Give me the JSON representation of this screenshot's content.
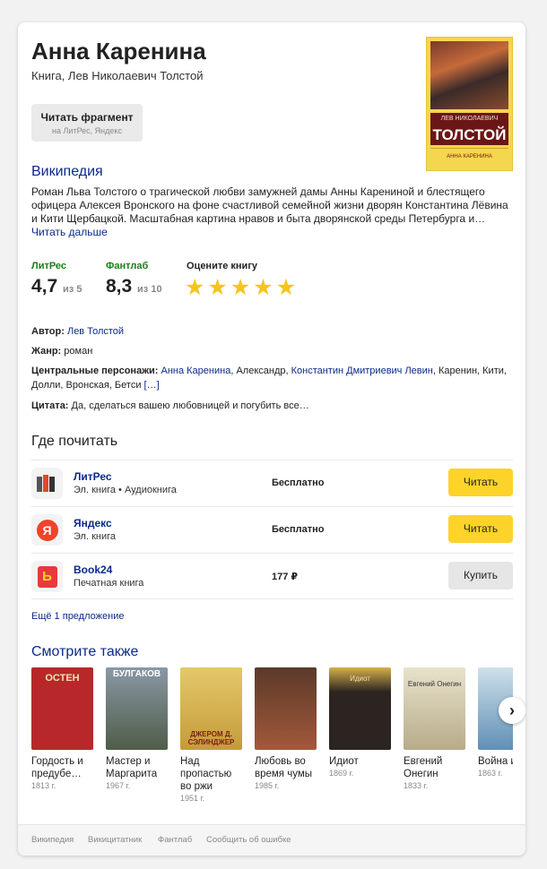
{
  "header": {
    "title": "Анна Каренина",
    "subtitle": "Книга, Лев Николаевич Толстой",
    "cover": {
      "author_line": "ЛЕВ НИКОЛАЕВИЧ",
      "name": "ТОЛСТОЙ",
      "title_line": "АННА КАРЕНИНА",
      "color": "#f5d64f"
    }
  },
  "fragment_button": {
    "label": "Читать фрагмент",
    "sub": "на ЛитРес, Яндекс"
  },
  "wiki": {
    "heading": "Википедия",
    "text": "Роман Льва Толстого о трагической любви замужней дамы Анны Карениной и блестящего офицера Алексея Вронского на фоне счастливой семейной жизни дворян Константина Лёвина и Кити Щербацкой. Масштабная картина нравов и быта дворянской среды Петербурга и…",
    "more": "Читать дальше"
  },
  "ratings": [
    {
      "source": "ЛитРес",
      "value": "4,7",
      "scale": "из 5"
    },
    {
      "source": "Фантлаб",
      "value": "8,3",
      "scale": "из 10"
    }
  ],
  "rate_prompt": "Оцените книгу",
  "stars": [
    "★",
    "★",
    "★",
    "★",
    "★"
  ],
  "info": {
    "author_label": "Автор:",
    "author": "Лев Толстой",
    "genre_label": "Жанр:",
    "genre": "роман",
    "chars_label": "Центральные персонажи:",
    "char1": "Анна Каренина",
    "sep1": ", Александр, ",
    "char2": "Константин Дмитриевич Левин",
    "sep2": ", Каренин, Кити, Долли, Вронская, Бетси ",
    "chars_more": "[…]",
    "quote_label": "Цитата:",
    "quote": "Да, сделаться вашею любовницей и погубить все…"
  },
  "where": {
    "heading": "Где почитать",
    "shops": [
      {
        "name": "ЛитРес",
        "sub": "Эл. книга • Аудиокнига",
        "price": "Бесплатно",
        "button": "Читать"
      },
      {
        "name": "Яндекс",
        "sub": "Эл. книга",
        "price": "Бесплатно",
        "button": "Читать",
        "icon": "Я"
      },
      {
        "name": "Book24",
        "sub": "Печатная книга",
        "price": "177 ₽",
        "button": "Купить",
        "icon": "Ь"
      }
    ],
    "more": "Ещё 1 предложение"
  },
  "see_also": {
    "heading": "Смотрите также",
    "books": [
      {
        "title": "Гордость и предубе…",
        "year": "1813 г.",
        "cover": "ОСТЕН",
        "color": "#b8282a"
      },
      {
        "title": "Мастер и Маргарита",
        "year": "1967 г.",
        "cover": "БУЛГАКОВ",
        "color": "#6a7b8a"
      },
      {
        "title": "Над пропастью во ржи",
        "year": "1951 г.",
        "cover": "ДЖЕРОМ Д. СЭЛИНДЖЕР",
        "color": "#e8c94a"
      },
      {
        "title": "Любовь во время чумы",
        "year": "1985 г.",
        "cover": "",
        "color": "#7a3b1e"
      },
      {
        "title": "Идиот",
        "year": "1869 г.",
        "cover": "Идиот",
        "color": "#c49a2a"
      },
      {
        "title": "Евгений Онегин",
        "year": "1833 г.",
        "cover": "Евгений Онегин",
        "color": "#c9c2a8"
      },
      {
        "title": "Война и мир",
        "year": "1863 г.",
        "cover": "",
        "color": "#7fa8c8"
      }
    ]
  },
  "footer": {
    "links": [
      "Википедия",
      "Викицитатник",
      "Фантлаб",
      "Сообщить об ошибке"
    ]
  }
}
